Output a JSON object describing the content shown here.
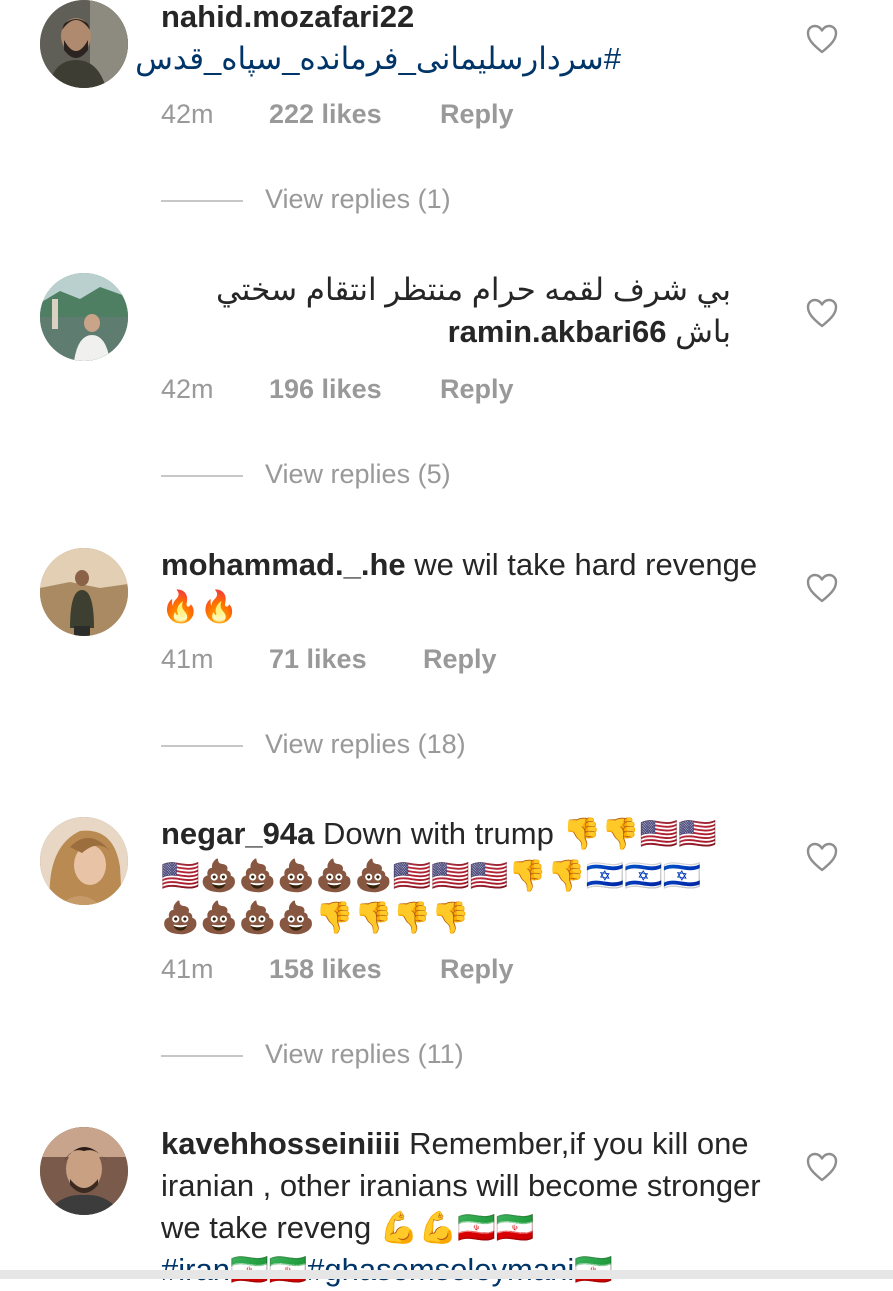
{
  "comments": [
    {
      "username": "nahid.mozafari22",
      "text": "#سردارسلیمانی_فرمانده_سپاه_قدس",
      "time": "42m",
      "likes": "222 likes",
      "reply": "Reply",
      "view_replies": "View replies (1)"
    },
    {
      "username": "ramin.akbari66",
      "text": "بي شرف لقمه حرام منتظر انتقام سختي باش",
      "time": "42m",
      "likes": "196 likes",
      "reply": "Reply",
      "view_replies": "View replies (5)"
    },
    {
      "username": "mohammad._.he",
      "text": "we wil take hard revenge",
      "emoji": "🔥🔥",
      "time": "41m",
      "likes": "71 likes",
      "reply": "Reply",
      "view_replies": "View replies (18)"
    },
    {
      "username": "negar_94a",
      "text": "Down with trump",
      "emoji_line1": "👎👎🇺🇸🇺🇸",
      "emoji_line2": "🇺🇸💩💩💩💩💩🇺🇸🇺🇸🇺🇸👎👎🇮🇱🇮🇱🇮🇱",
      "emoji_line3": "💩💩💩💩👎👎👎👎",
      "time": "41m",
      "likes": "158 likes",
      "reply": "Reply",
      "view_replies": "View replies (11)"
    },
    {
      "username": "kavehhosseiniiii",
      "text": "Remember,if you kill one iranian , other iranians will become stronger we take reveng",
      "emoji": "💪💪🇮🇷🇮🇷",
      "hashtag1": "#iran",
      "hashtag1_emoji": "🇮🇷🇮🇷",
      "hashtag2": "#ghasemsoleymani",
      "hashtag2_emoji": "🇮🇷"
    }
  ],
  "icons": {
    "like": "heart-outline-icon"
  },
  "colors": {
    "text": "#262626",
    "muted": "#999999",
    "hashtag": "#003569",
    "divider": "#c7c7c7"
  }
}
